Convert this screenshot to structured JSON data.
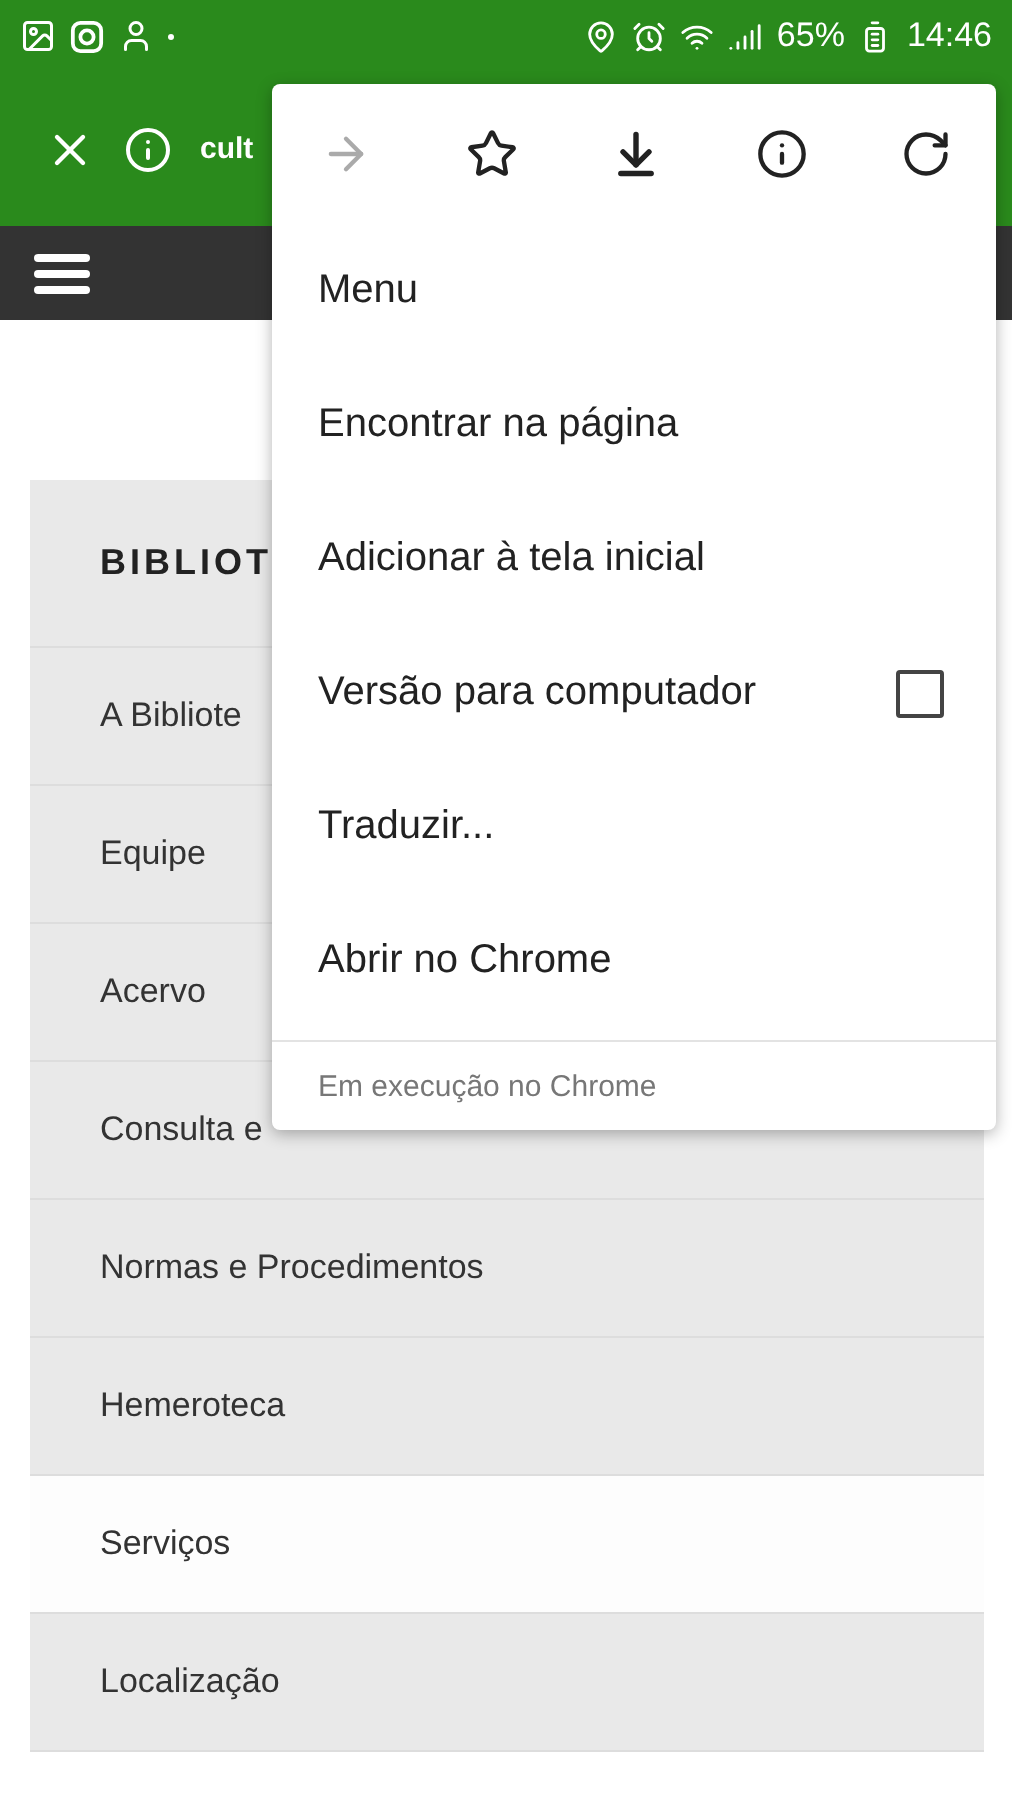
{
  "status_bar": {
    "battery": "65%",
    "time": "14:46"
  },
  "toolbar": {
    "url": "cult"
  },
  "menu_actions": [
    {
      "kind": "forward",
      "disabled": true
    },
    {
      "kind": "bookmark",
      "disabled": false
    },
    {
      "kind": "download",
      "disabled": false
    },
    {
      "kind": "info",
      "disabled": false
    },
    {
      "kind": "reload",
      "disabled": false
    }
  ],
  "menu": {
    "items": [
      {
        "label": "Menu",
        "kind": "plain"
      },
      {
        "label": "Encontrar na página",
        "kind": "plain"
      },
      {
        "label": "Adicionar à tela inicial",
        "kind": "plain"
      },
      {
        "label": "Versão para computador",
        "kind": "checkbox",
        "checked": false
      },
      {
        "label": "Traduzir...",
        "kind": "plain"
      },
      {
        "label": "Abrir no Chrome",
        "kind": "plain"
      }
    ],
    "footer": "Em execução no Chrome"
  },
  "sidebar": {
    "title": "BIBLIOT",
    "items": [
      {
        "label": "A Bibliote",
        "selected": false
      },
      {
        "label": "Equipe",
        "selected": false
      },
      {
        "label": "Acervo",
        "selected": false
      },
      {
        "label": "Consulta e",
        "selected": false
      },
      {
        "label": "Normas e Procedimentos",
        "selected": false
      },
      {
        "label": "Hemeroteca",
        "selected": false
      },
      {
        "label": "Serviços",
        "selected": true
      },
      {
        "label": "Localização",
        "selected": false
      }
    ]
  }
}
